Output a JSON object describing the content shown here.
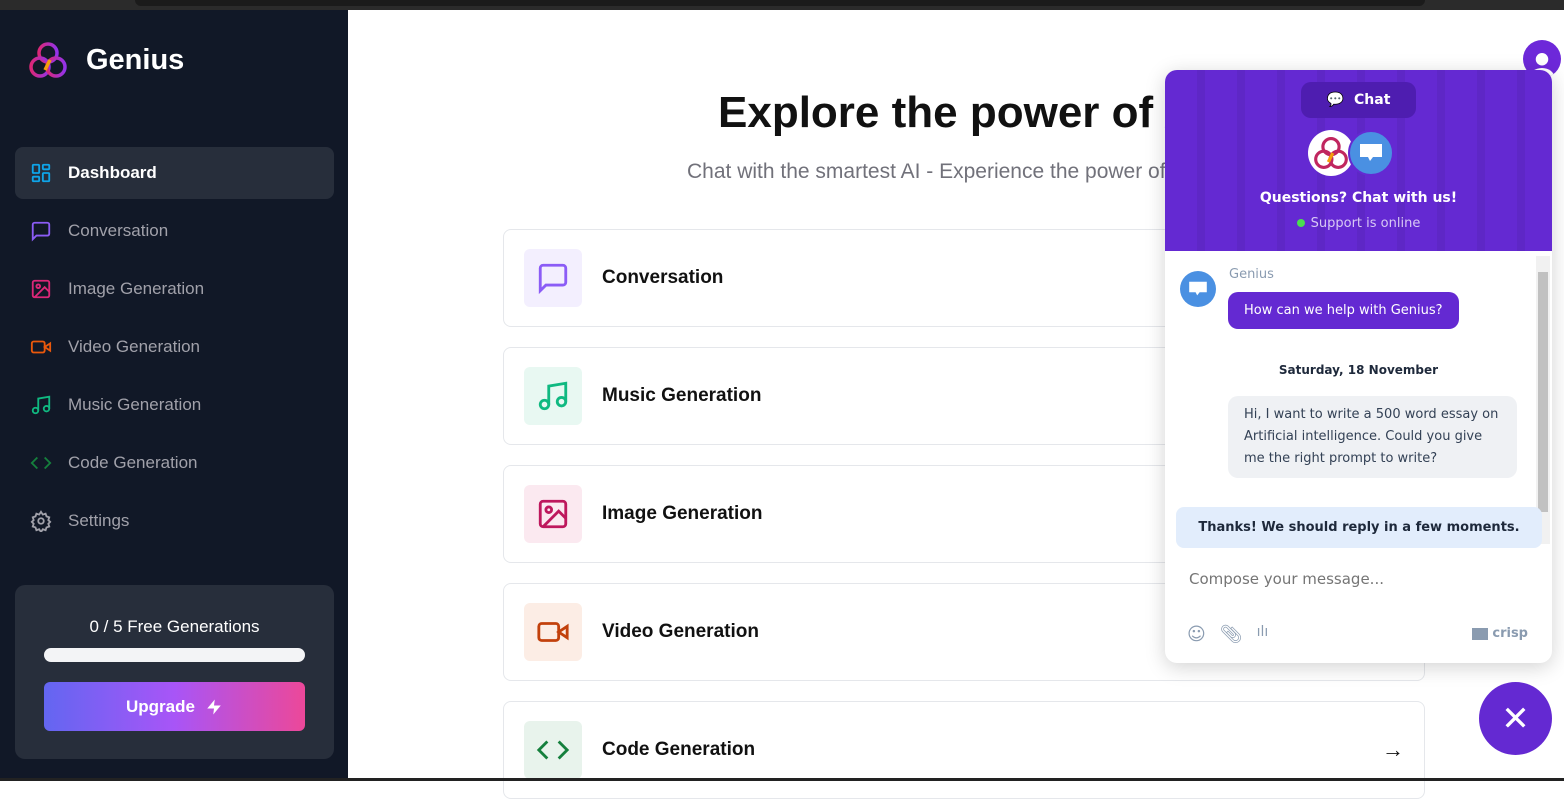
{
  "sidebar": {
    "brand": "Genius",
    "items": [
      {
        "label": "Dashboard",
        "color": "#0ea5e9"
      },
      {
        "label": "Conversation",
        "color": "#8b5cf6"
      },
      {
        "label": "Image Generation",
        "color": "#db2777"
      },
      {
        "label": "Video Generation",
        "color": "#ea580c"
      },
      {
        "label": "Music Generation",
        "color": "#10b981"
      },
      {
        "label": "Code Generation",
        "color": "#15803d"
      },
      {
        "label": "Settings",
        "color": "#a1a1aa"
      }
    ],
    "free": {
      "text": "0 / 5 Free Generations",
      "used": 0,
      "total": 5
    },
    "upgrade_label": "Upgrade"
  },
  "main": {
    "title": "Explore the power of AI",
    "subtitle": "Chat with the smartest AI - Experience the power of AI",
    "cards": [
      {
        "label": "Conversation",
        "icon": "message-square-icon"
      },
      {
        "label": "Music Generation",
        "icon": "music-icon"
      },
      {
        "label": "Image Generation",
        "icon": "image-icon"
      },
      {
        "label": "Video Generation",
        "icon": "video-icon"
      },
      {
        "label": "Code Generation",
        "icon": "code-icon"
      }
    ]
  },
  "chat": {
    "tab": "Chat",
    "heading": "Questions? Chat with us!",
    "status": "Support is online",
    "operator": "Genius",
    "operator_msg": "How can we help with Genius?",
    "date": "Saturday, 18 November",
    "user_msg": "Hi, I want to write a 500 word essay on Artificial intelligence. Could you give me the right prompt to write?",
    "notice": "Thanks! We should reply in a few moments.",
    "placeholder": "Compose your message...",
    "brand": "crisp"
  }
}
